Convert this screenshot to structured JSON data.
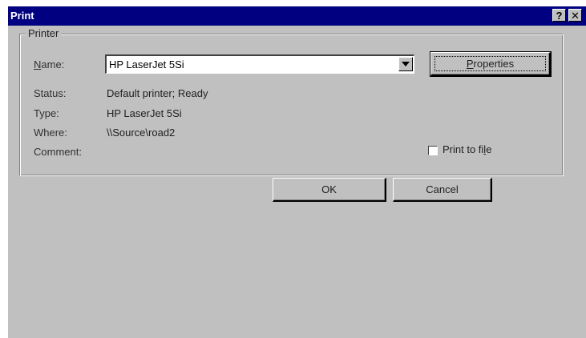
{
  "window": {
    "title": "Print",
    "help_glyph": "?",
    "close_glyph": "✕",
    "help_icon": "question-icon",
    "close_icon": "close-icon"
  },
  "printer_group": {
    "legend": "Printer",
    "name_label_prefix": "",
    "name_label_access": "N",
    "name_label_rest": "ame:",
    "name_value": "HP LaserJet 5Si",
    "status_label": "Status:",
    "status_value": "Default printer; Ready",
    "type_label": "Type:",
    "type_value": "HP LaserJet 5Si",
    "where_label": "Where:",
    "where_value": "\\\\Source\\road2",
    "comment_label": "Comment:",
    "properties_access": "P",
    "properties_rest": "roperties",
    "print_to_file_prefix": "Print to fi",
    "print_to_file_access": "l",
    "print_to_file_rest": "e",
    "print_to_file_checked": false
  },
  "buttons": {
    "ok": "OK",
    "cancel": "Cancel"
  },
  "colors": {
    "titlebar": "#000080",
    "face": "#c0c0c0",
    "title_text": "#ffffff"
  }
}
